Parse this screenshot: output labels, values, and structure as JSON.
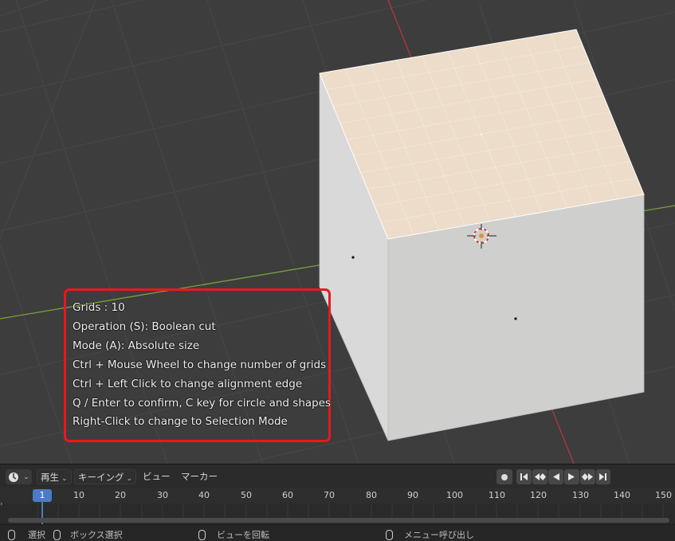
{
  "overlay": {
    "lines": [
      "Grids : 10",
      "Operation (S): Boolean cut",
      "Mode (A): Absolute size",
      "Ctrl + Mouse Wheel to change number of grids",
      "Ctrl + Left Click to change alignment edge",
      "Q / Enter to confirm, C key for circle and shapes",
      "Right-Click to change to Selection Mode"
    ],
    "border_color": "#e6191e"
  },
  "timeline": {
    "menus": {
      "playback": "再生",
      "keying": "キーイング",
      "view": "ビュー",
      "marker": "マーカー"
    },
    "current_frame": "1",
    "ticks": [
      "10",
      "20",
      "30",
      "40",
      "50",
      "60",
      "70",
      "80",
      "90",
      "100",
      "110",
      "120",
      "130",
      "140",
      "150"
    ]
  },
  "statusbar": {
    "select": "選択",
    "box_select": "ボックス選択",
    "rotate_view": "ビューを回転",
    "call_menu": "メニュー呼び出し"
  },
  "colors": {
    "viewport_bg": "#3d3d3d",
    "x_axis": "#7aa13a",
    "y_axis": "#b3363f",
    "cube_top": "#ecdcc9",
    "accent": "#4d7ac4"
  }
}
